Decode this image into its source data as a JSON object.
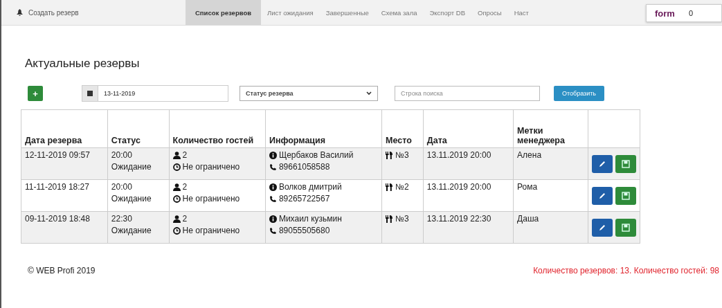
{
  "navbar": {
    "create": "Создать резерв",
    "tabs": [
      {
        "label": "Список резервов",
        "selected": true
      },
      {
        "label": "Лист ожидания",
        "selected": false
      },
      {
        "label": "Завершенные",
        "selected": false
      },
      {
        "label": "Схема зала",
        "selected": false
      },
      {
        "label": "Экспорт DB",
        "selected": false
      },
      {
        "label": "Опросы",
        "selected": false
      },
      {
        "label": "Наст",
        "selected": false
      }
    ],
    "tooltip": {
      "name": "form",
      "value": "0"
    }
  },
  "title": "Актуальные резервы",
  "toolbar": {
    "add": "+",
    "date": "13-11-2019",
    "status_select": "Статус резерва",
    "search": {
      "placeholder": "Строка поиска"
    },
    "show": "Отобразить"
  },
  "table": {
    "columns": [
      "Дата резерва",
      "Статус",
      "Количество гостей",
      "Информация",
      "Место",
      "Дата",
      "Метки менеджера"
    ],
    "rows": [
      {
        "created": "12-11-2019 09:57",
        "time": "20:00",
        "status": "Ожидание",
        "guests": "2",
        "duration": "Не ограничено",
        "name": "Щербаков Василий",
        "phone": "89661058588",
        "place": "№3",
        "date": "13.11.2019 20:00",
        "manager": "Алена"
      },
      {
        "created": "11-11-2019 18:27",
        "time": "20:00",
        "status": "Ожидание",
        "guests": "2",
        "duration": "Не ограничено",
        "name": "Волков дмитрий",
        "phone": "89265722567",
        "place": "№2",
        "date": "13.11.2019 20:00",
        "manager": "Рома"
      },
      {
        "created": "09-11-2019 18:48",
        "time": "22:30",
        "status": "Ожидание",
        "guests": "2",
        "duration": "Не ограничено",
        "name": "Михаил кузьмин",
        "phone": "89055505680",
        "place": "№3",
        "date": "13.11.2019 22:30",
        "manager": "Даша"
      }
    ]
  },
  "footer": {
    "copyright": "© WEB Profi 2019",
    "summary": "Количество резервов: 13. Количество гостей: 98"
  }
}
